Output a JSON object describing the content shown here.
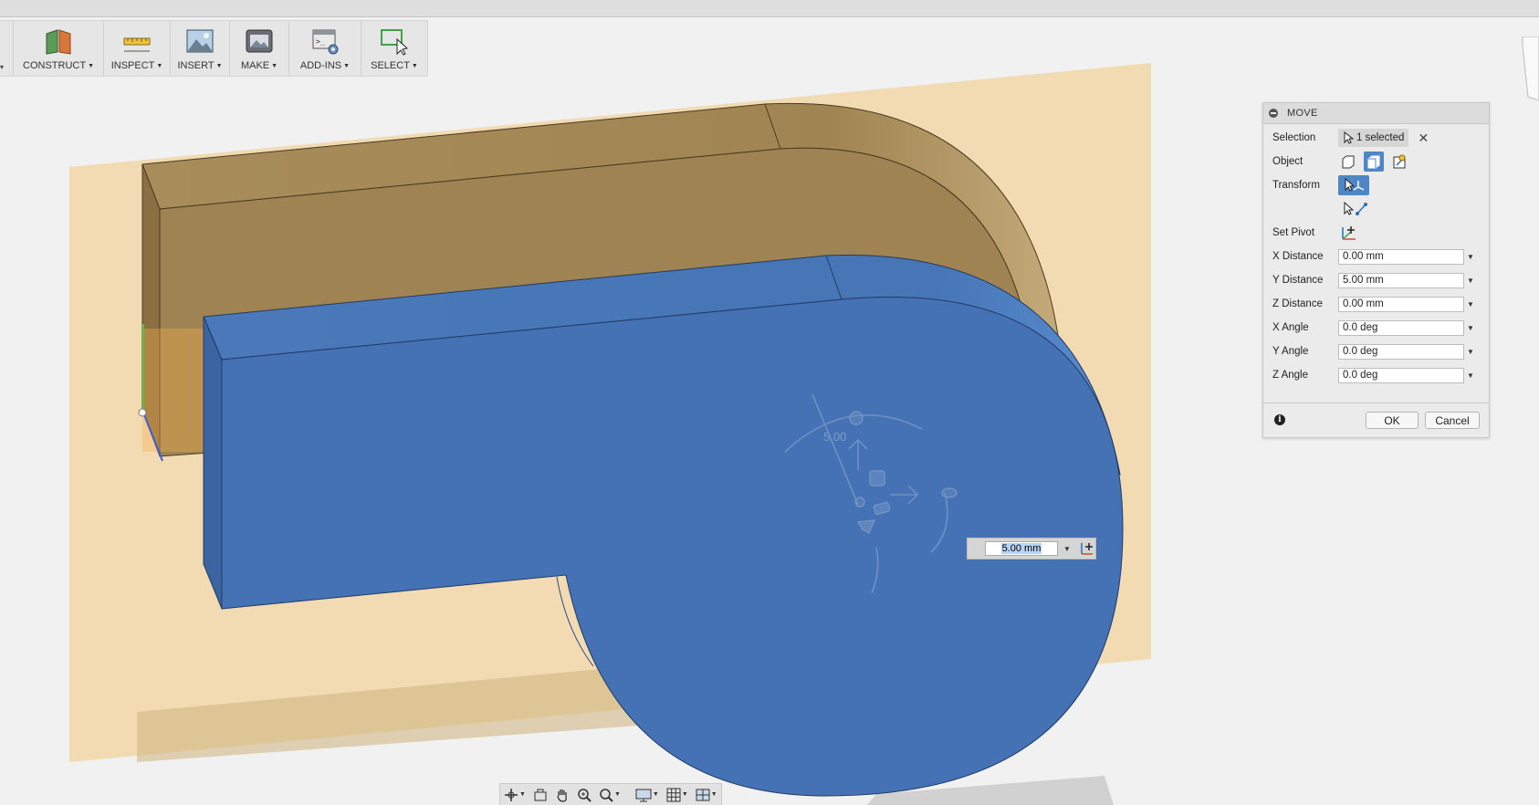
{
  "toolbar": {
    "groups": [
      {
        "label": "CONSTRUCT",
        "icon": "construct-plane-icon"
      },
      {
        "label": "INSPECT",
        "icon": "ruler-icon"
      },
      {
        "label": "INSERT",
        "icon": "image-icon"
      },
      {
        "label": "MAKE",
        "icon": "3d-print-icon"
      },
      {
        "label": "ADD-INS",
        "icon": "scripts-icon"
      },
      {
        "label": "SELECT",
        "icon": "select-window-icon"
      }
    ]
  },
  "move_panel": {
    "title": "MOVE",
    "selection": {
      "label": "Selection",
      "value": "1 selected"
    },
    "object": {
      "label": "Object",
      "options": [
        "face-icon",
        "body-icon",
        "component-icon"
      ],
      "active": "body-icon"
    },
    "transform": {
      "label": "Transform",
      "options": [
        "free-move-icon",
        "point-to-point-icon"
      ]
    },
    "set_pivot": {
      "label": "Set Pivot"
    },
    "fields": [
      {
        "label": "X Distance",
        "value": "0.00 mm"
      },
      {
        "label": "Y Distance",
        "value": "5.00 mm"
      },
      {
        "label": "Z Distance",
        "value": "0.00 mm"
      },
      {
        "label": "X Angle",
        "value": "0.0 deg"
      },
      {
        "label": "Y Angle",
        "value": "0.0 deg"
      },
      {
        "label": "Z Angle",
        "value": "0.0 deg"
      }
    ],
    "ok_label": "OK",
    "cancel_label": "Cancel"
  },
  "float_input": {
    "value": "5.00 mm"
  },
  "manipulator": {
    "label": "5.00"
  },
  "colors": {
    "sketch_plane": "#f2d7a7",
    "body_tan": "#a88b58",
    "body_blue": "#4472b4",
    "active_button": "#4f86c6"
  }
}
